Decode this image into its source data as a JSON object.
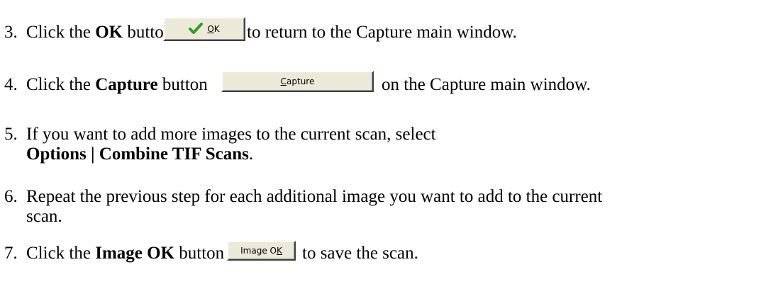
{
  "steps": [
    {
      "number": "3.",
      "pre": "Click the ",
      "bold": "OK",
      "mid": " button",
      "post": "to return to the Capture main window.",
      "button": {
        "label_underline": "O",
        "label_rest": "K",
        "icon": "check-icon"
      }
    },
    {
      "number": "4.",
      "pre": "Click the ",
      "bold": "Capture",
      "mid": " button",
      "post": "on the Capture main window.",
      "button": {
        "label_underline": "C",
        "label_rest": "apture"
      }
    },
    {
      "number": "5.",
      "line1": "If you want to add more images to the current scan, select",
      "bold": "Options | Combine TIF Scans",
      "post": "."
    },
    {
      "number": "6.",
      "line1": "Repeat the previous step for each additional image you want to add to the current",
      "line2": "scan."
    },
    {
      "number": "7.",
      "pre": "Click the ",
      "bold": "Image OK",
      "mid": " button",
      "post": "to save the scan.",
      "button": {
        "label_pre": "Image O",
        "label_underline": "K"
      }
    }
  ],
  "colors": {
    "button_face": "#ece9d8",
    "check_icon": "#2e9e2e"
  }
}
